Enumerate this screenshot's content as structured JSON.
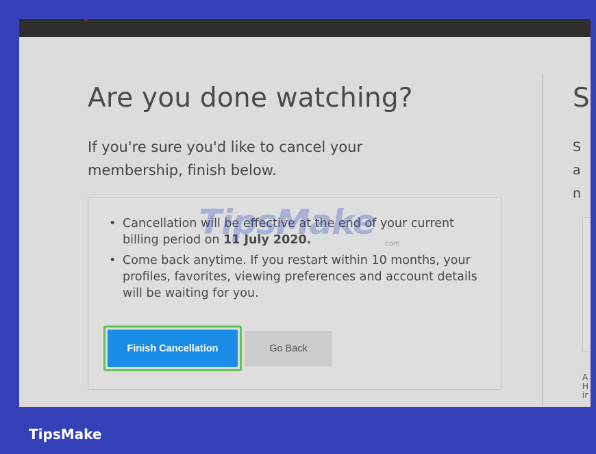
{
  "page": {
    "title": "Are you done watching?",
    "subtitle": "If you're sure you'd like to cancel your membership, finish below.",
    "right_title": "S",
    "right_letters": [
      "S",
      "a",
      "n"
    ],
    "right_small": [
      "A",
      "H",
      "ir"
    ]
  },
  "card": {
    "items": [
      {
        "text": "Cancellation will be effective at the end of your current billing period on ",
        "date": "11 July 2020."
      },
      {
        "text": "Come back anytime. If you restart within 10 months, your profiles, favorites, viewing preferences and account details will be waiting for you.",
        "date": ""
      }
    ],
    "finish_label": "Finish Cancellation",
    "back_label": "Go Back"
  },
  "watermark": {
    "text": "TipsMake",
    "small": ".com"
  },
  "brand": {
    "label": "TipsMake"
  },
  "colors": {
    "finish_button": "#1a8ee6",
    "highlight": "#5fc55a",
    "frame": "#3541b8",
    "topbar": "#2e2e2e"
  }
}
